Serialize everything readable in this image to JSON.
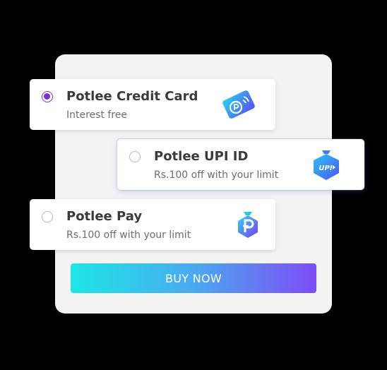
{
  "options": [
    {
      "title": "Potlee Credit Card",
      "subtitle": "Interest free",
      "selected": true,
      "icon": "credit-card-icon"
    },
    {
      "title": "Potlee UPI ID",
      "subtitle": "Rs.100 off with your limit",
      "selected": false,
      "icon": "upi-icon"
    },
    {
      "title": "Potlee Pay",
      "subtitle": "Rs.100 off with your limit",
      "selected": false,
      "icon": "potlee-pay-icon"
    }
  ],
  "buy_button": {
    "label": "BUY NOW"
  },
  "colors": {
    "accent": "#7b2fd6",
    "gradient_start": "#1ee6e6",
    "gradient_end": "#7f4cf7"
  }
}
